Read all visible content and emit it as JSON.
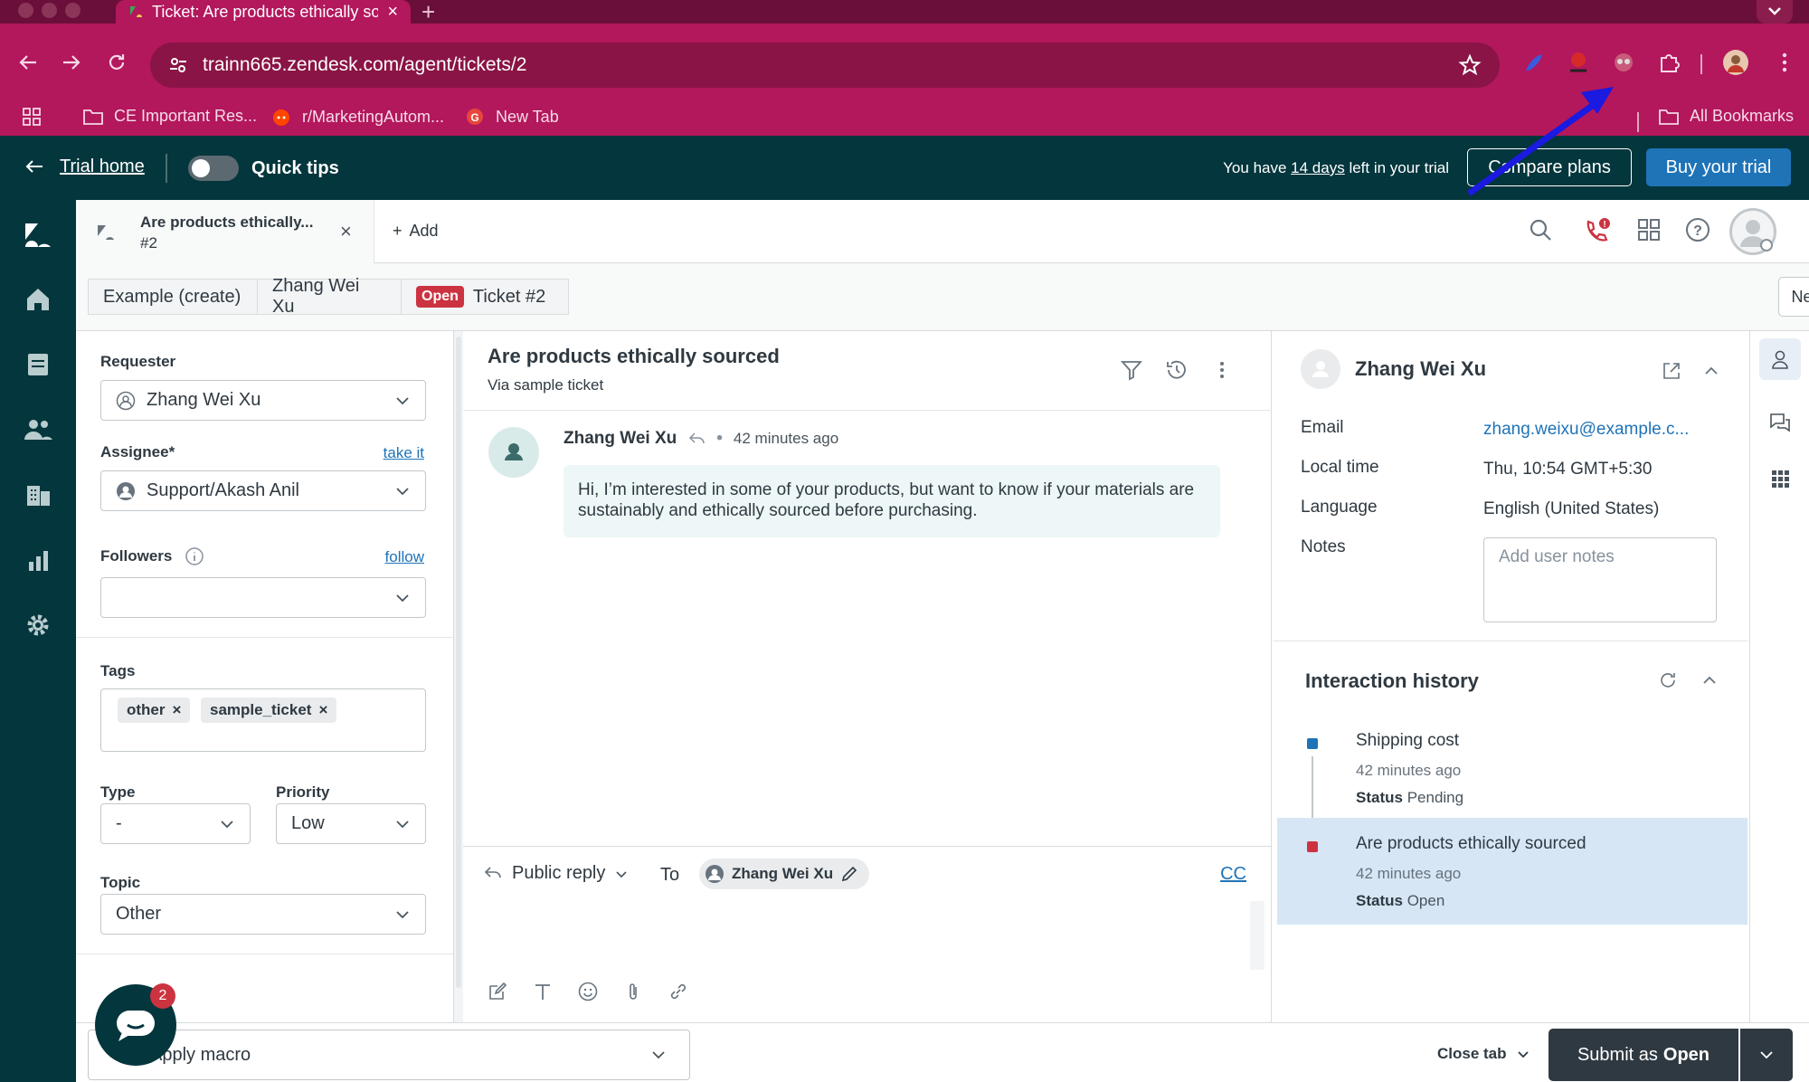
{
  "browser": {
    "tab_title": "Ticket: Are products ethically sourced",
    "url": "trainn665.zendesk.com/agent/tickets/2",
    "bookmarks": [
      "CE Important Res...",
      "r/MarketingAutom...",
      "New Tab"
    ],
    "all_bookmarks": "All Bookmarks"
  },
  "trial": {
    "home_label": "Trial home",
    "quick_tips": "Quick tips",
    "msg_prefix": "You have",
    "msg_days": "14 days",
    "msg_suffix": "left in your trial",
    "compare": "Compare plans",
    "buy": "Buy your trial"
  },
  "workspace": {
    "tab_title": "Are products ethically...",
    "tab_number": "#2",
    "add": "Add"
  },
  "breadcrumb": {
    "items": [
      "Example (create)",
      "Zhang Wei Xu"
    ],
    "status_badge": "Open",
    "ticket": "Ticket #2",
    "next": "Next"
  },
  "properties": {
    "requester_label": "Requester",
    "requester": "Zhang Wei Xu",
    "assignee_label": "Assignee*",
    "take_it": "take it",
    "assignee": "Support/Akash Anil",
    "followers_label": "Followers",
    "follow": "follow",
    "followers": "",
    "tags_label": "Tags",
    "tags": [
      "other",
      "sample_ticket"
    ],
    "type_label": "Type",
    "type": "-",
    "priority_label": "Priority",
    "priority": "Low",
    "topic_label": "Topic",
    "topic": "Other"
  },
  "conversation": {
    "subject": "Are products ethically sourced",
    "via": "Via sample ticket",
    "author": "Zhang Wei Xu",
    "time": "42 minutes ago",
    "body": "Hi, I’m interested in some of your products, but want to know if your materials are sustainably and ethically sourced before purchasing."
  },
  "composer": {
    "reply_type": "Public reply",
    "to_label": "To",
    "to": "Zhang Wei Xu",
    "cc": "CC"
  },
  "user": {
    "name": "Zhang Wei Xu",
    "email_label": "Email",
    "email": "zhang.weixu@example.c...",
    "local_time_label": "Local time",
    "local_time": "Thu, 10:54 GMT+5:30",
    "language_label": "Language",
    "language": "English (United States)",
    "notes_label": "Notes",
    "notes_placeholder": "Add user notes"
  },
  "interaction_history": {
    "title": "Interaction history",
    "items": [
      {
        "title": "Shipping cost",
        "time": "42 minutes ago",
        "status_label": "Status",
        "status": "Pending",
        "color": "#1f73b7"
      },
      {
        "title": "Are products ethically sourced",
        "time": "42 minutes ago",
        "status_label": "Status",
        "status": "Open",
        "color": "#cc3340"
      }
    ]
  },
  "bottom": {
    "macro": "Apply macro",
    "close_tab": "Close tab",
    "submit_prefix": "Submit as",
    "submit_status": "Open",
    "chat_count": "2"
  },
  "colors": {
    "brand": "#03363d",
    "browser": "#b3175c",
    "accent": "#1f73b7",
    "annotation_arrow": "#1a1ae0"
  }
}
